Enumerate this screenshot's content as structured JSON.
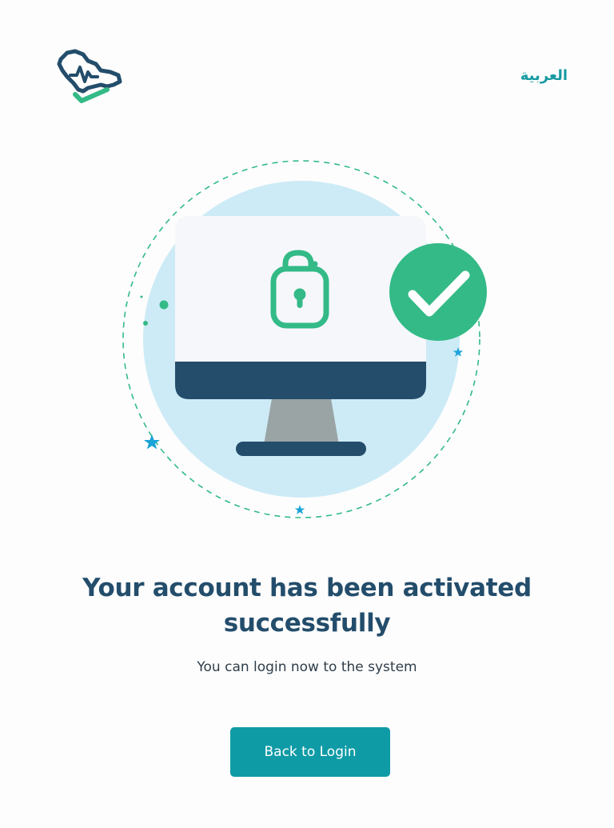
{
  "header": {
    "language_link": "العربية",
    "logo_icon": "health-map-logo-icon"
  },
  "illustration": {
    "monitor_icon": "computer-monitor-icon",
    "lock_icon": "unlocked-padlock-icon",
    "check_icon": "check-circle-icon",
    "colors": {
      "navy": "#234d6b",
      "green": "#33ba87",
      "light_blue": "#cdebf6",
      "screen": "#f6f7fb",
      "stand": "#9aa4a5",
      "star": "#1ba3d8"
    }
  },
  "main": {
    "title": "Your account has been activated successfully",
    "subtitle": "You can login now to the system",
    "back_button_label": "Back to Login"
  },
  "theme": {
    "primary": "#0f9ba6",
    "heading": "#234d6b",
    "accent_green": "#33ba87"
  }
}
